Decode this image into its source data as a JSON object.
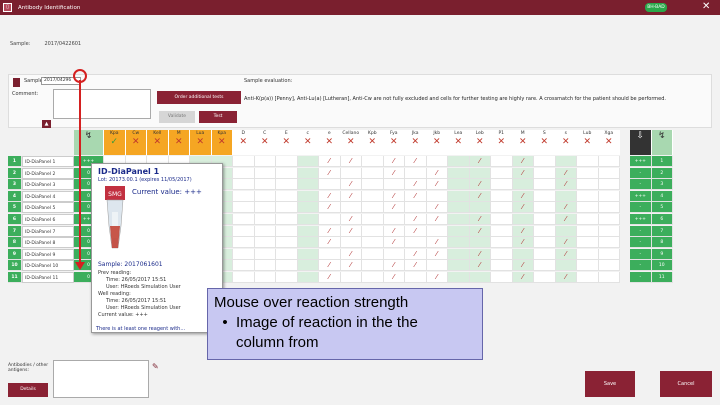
{
  "window": {
    "title": "Antibody Identification",
    "badge": "BH-BAD",
    "close_glyph": "✕",
    "icon_glyph": "▯"
  },
  "sample_row": {
    "label": "Sample:",
    "value": "2017/0422601"
  },
  "upper": {
    "sample_label": "Sample:",
    "sample_value": "2017/04296",
    "comment_label": "Comment:",
    "small_btn": "▲",
    "order_button": "Order additional tests",
    "validate_button": "Validate",
    "test_button": "Test",
    "sample_evaluation_label": "Sample evaluation:",
    "sample_evaluation_text": "Anti-K(p(a)) [Penny], Anti-Lu(a) [Lutheran], Anti-Cw are not fully excluded and cells for further testing are highly rare. A crossmatch for the patient should be performed."
  },
  "grid": {
    "header_first": {
      "label": "",
      "mark": "↯"
    },
    "columns": [
      {
        "label": "Kpa",
        "style": "orange",
        "mark": "✓"
      },
      {
        "label": "Cw",
        "style": "orange",
        "mark": "✕"
      },
      {
        "label": "Kell",
        "style": "orange",
        "mark": "✕"
      },
      {
        "label": "M",
        "style": "orange",
        "mark": "✕"
      },
      {
        "label": "Lua",
        "style": "orange",
        "mark": "✕"
      },
      {
        "label": "Kpa",
        "style": "orange",
        "mark": "✕"
      },
      {
        "label": "D",
        "style": "white",
        "mark": "✕"
      },
      {
        "label": "C",
        "style": "white",
        "mark": "✕"
      },
      {
        "label": "E",
        "style": "white",
        "mark": "✕"
      },
      {
        "label": "c",
        "style": "white",
        "mark": "✕"
      },
      {
        "label": "e",
        "style": "white",
        "mark": "✕"
      },
      {
        "label": "Cellano",
        "style": "white",
        "mark": "✕"
      },
      {
        "label": "Kpb",
        "style": "white",
        "mark": "✕"
      },
      {
        "label": "Fya",
        "style": "white",
        "mark": "✕"
      },
      {
        "label": "Jka",
        "style": "white",
        "mark": "✕"
      },
      {
        "label": "Jkb",
        "style": "white",
        "mark": "✕"
      },
      {
        "label": "Lea",
        "style": "white",
        "mark": "✕"
      },
      {
        "label": "Leb",
        "style": "white",
        "mark": "✕"
      },
      {
        "label": "P1",
        "style": "white",
        "mark": "✕"
      },
      {
        "label": "M",
        "style": "white",
        "mark": "✕"
      },
      {
        "label": "S",
        "style": "white",
        "mark": "✕"
      },
      {
        "label": "s",
        "style": "white",
        "mark": "✕"
      },
      {
        "label": "Lub",
        "style": "white",
        "mark": "✕"
      },
      {
        "label": "Xga",
        "style": "white",
        "mark": "✕"
      }
    ],
    "tail_headers": [
      {
        "label": "",
        "mark": "⇩",
        "style": "dark"
      },
      {
        "label": "",
        "mark": "↯",
        "style": "green"
      }
    ],
    "rows": [
      {
        "num": "1",
        "name": "ID-DiaPanel 1",
        "result": "+++",
        "tail": "+++"
      },
      {
        "num": "2",
        "name": "ID-DiaPanel 2",
        "result": "0",
        "tail": "-"
      },
      {
        "num": "3",
        "name": "ID-DiaPanel 3",
        "result": "0",
        "tail": "-"
      },
      {
        "num": "4",
        "name": "ID-DiaPanel 4",
        "result": "0",
        "tail": "+++"
      },
      {
        "num": "5",
        "name": "ID-DiaPanel 5",
        "result": "0",
        "tail": "-"
      },
      {
        "num": "6",
        "name": "ID-DiaPanel 6",
        "result": "+++",
        "tail": "+++"
      },
      {
        "num": "7",
        "name": "ID-DiaPanel 7",
        "result": "0",
        "tail": "-"
      },
      {
        "num": "8",
        "name": "ID-DiaPanel 8",
        "result": "0",
        "tail": "-"
      },
      {
        "num": "9",
        "name": "ID-DiaPanel 9",
        "result": "0",
        "tail": "-"
      },
      {
        "num": "10",
        "name": "ID-DiaPanel 10",
        "result": "0",
        "tail": "-"
      },
      {
        "num": "11",
        "name": "ID-DiaPanel 11",
        "result": "0",
        "tail": "-"
      }
    ]
  },
  "popup": {
    "title": "ID-DiaPanel 1",
    "lot": "Lot: 20173.00.1 (expires 11/05/2017)",
    "value_label": "Current value: +++",
    "sample": "Sample: 2017061601",
    "line1": "Prev reading:",
    "line2": "Time: 26/05/2017 15:51",
    "line3": "User: HRoeds Simulation User",
    "line4": "Well reading:",
    "line5": "Time: 26/05/2017 15:51",
    "line6": "User: HRoeds Simulation User",
    "line7": "Current value: +++",
    "note": "There is at least one reagent with...",
    "tube_label": "SMG"
  },
  "callout": {
    "title": "Mouse over reaction strength",
    "bullet": "•",
    "bullet_text_1": "Image of reaction in the the",
    "bullet_text_2": "column from"
  },
  "footer": {
    "antibodies_label": "Antibodies / other antigens:",
    "details_button": "Details",
    "save_button": "Save",
    "cancel_button": "Cancel",
    "edit_icon": "✎"
  },
  "colors": {
    "accent": "#7a1f2e",
    "positive": "#3cae5c",
    "highlight": "#f5a623",
    "callout": "#c8c8f2",
    "annotation": "#d42020"
  }
}
